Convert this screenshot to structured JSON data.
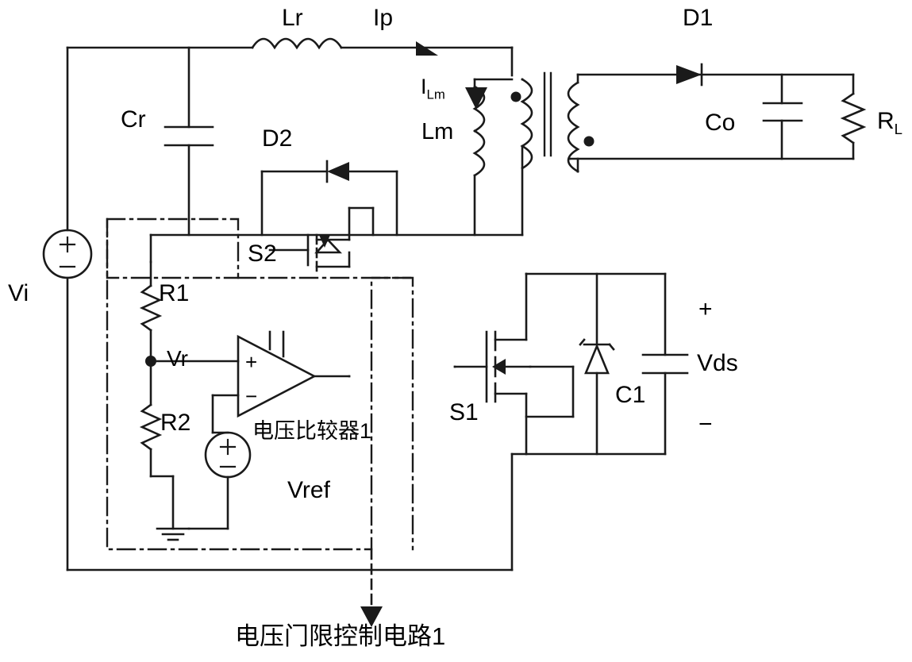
{
  "diagram": {
    "title_caption": "电压门限控制电路1",
    "type": "circuit-schematic",
    "labels": {
      "vi": "Vi",
      "cr": "Cr",
      "lr": "Lr",
      "ip": "Ip",
      "ilm_main": "I",
      "ilm_sub": "Lm",
      "lm": "Lm",
      "d1": "D1",
      "co": "Co",
      "rl_main": "R",
      "rl_sub": "L",
      "d2": "D2",
      "s2": "S2",
      "s1": "S1",
      "c1": "C1",
      "vds": "Vds",
      "plus_vds": "+",
      "minus_vds": "−",
      "r1": "R1",
      "r2": "R2",
      "vr": "Vr",
      "comparator": "电压比较器1",
      "vref": "Vref",
      "opamp_plus": "+",
      "opamp_minus": "−",
      "src_plus": "+",
      "src_minus": "−",
      "vref_plus": "+",
      "vref_minus": "−"
    },
    "colors": {
      "wire": "#1a1a1a",
      "background": "#ffffff",
      "dashed_box": "#1a1a1a"
    }
  }
}
